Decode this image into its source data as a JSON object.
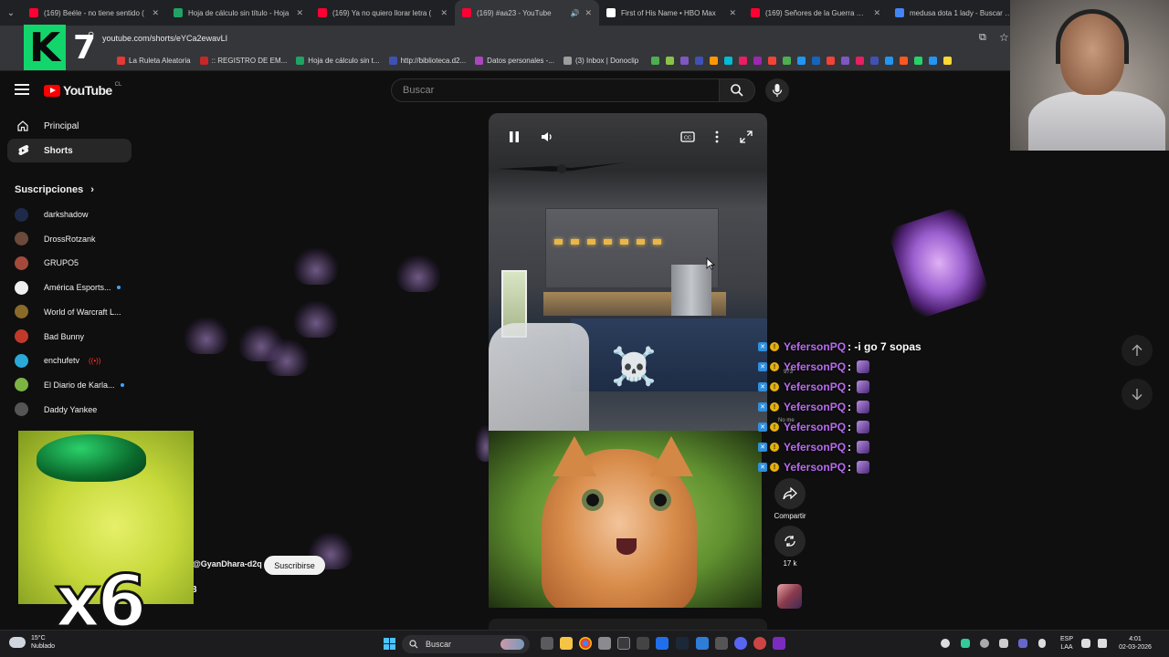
{
  "browser": {
    "tabs": [
      {
        "title": "(169) Beéle - no tiene sentido (",
        "favicon_color": "#ff0033",
        "active": false,
        "muted": false
      },
      {
        "title": "Hoja de cálculo sin título - Hoja",
        "favicon_color": "#1fa463",
        "active": false,
        "muted": false
      },
      {
        "title": "(169) Ya no quiero llorar letra (",
        "favicon_color": "#ff0033",
        "active": false,
        "muted": false
      },
      {
        "title": "(169) #aa23 - YouTube",
        "favicon_color": "#ff0033",
        "active": true,
        "muted": true
      },
      {
        "title": "First of His Name • HBO Max",
        "favicon_color": "#ffffff",
        "active": false,
        "muted": false
      },
      {
        "title": "(169) Señores de la Guerra — F",
        "favicon_color": "#ff0033",
        "active": false,
        "muted": false
      },
      {
        "title": "medusa dota 1 lady - Buscar co",
        "favicon_color": "#4285f4",
        "active": false,
        "muted": false
      }
    ],
    "close_glyph": "✕",
    "url": "youtube.com/shorts/eYCa2ewavLI",
    "bookmarks": [
      {
        "label": "La Ruleta Aleatoria",
        "color": "#e53935"
      },
      {
        "label": ":: REGISTRO DE EM...",
        "color": "#c62828"
      },
      {
        "label": "Hoja de cálculo sin t...",
        "color": "#1fa463"
      },
      {
        "label": "http://biblioteca.d2...",
        "color": "#3f51b5"
      },
      {
        "label": "Datos personales -...",
        "color": "#ab47bc"
      },
      {
        "label": "(3) Inbox | Donoclip",
        "color": "#9e9e9e"
      }
    ],
    "bookmark_icon_colors": [
      "#4caf50",
      "#8bc34a",
      "#7e57c2",
      "#3f51b5",
      "#ff9800",
      "#00bcd4",
      "#e91e63",
      "#9c27b0",
      "#f44336",
      "#4caf50",
      "#2196f3",
      "#1565c0",
      "#f44336",
      "#7e57c2",
      "#e91e63",
      "#3f51b5",
      "#2196f3",
      "#ff5722",
      "#25d366",
      "#2196f3",
      "#fdd835"
    ]
  },
  "overlay_logo": {
    "letter": "K",
    "number": "7"
  },
  "youtube": {
    "logo_text": "YouTube",
    "country_code": "CL",
    "search_placeholder": "Buscar",
    "sidebar": {
      "items": [
        {
          "label": "Principal",
          "icon": "home-icon"
        },
        {
          "label": "Shorts",
          "icon": "shorts-icon"
        }
      ],
      "subscriptions_title": "Suscripciones",
      "subscriptions_chevron": "›",
      "channels": [
        {
          "name": "darkshadow",
          "avatar_color": "#1d2a4a",
          "dot": false,
          "live": false
        },
        {
          "name": "DrossRotzank",
          "avatar_color": "#6b4a3a",
          "dot": false,
          "live": false
        },
        {
          "name": "GRUPO5",
          "avatar_color": "#a34a3a",
          "dot": false,
          "live": false
        },
        {
          "name": "América Esports...",
          "avatar_color": "#f0f0f0",
          "dot": true,
          "live": false
        },
        {
          "name": "World of Warcraft L...",
          "avatar_color": "#8a6a2a",
          "dot": false,
          "live": false
        },
        {
          "name": "Bad Bunny",
          "avatar_color": "#c0392b",
          "dot": false,
          "live": false
        },
        {
          "name": "enchufetv",
          "avatar_color": "#2aa8d8",
          "dot": false,
          "live": true
        },
        {
          "name": "El Diario de Karla...",
          "avatar_color": "#7cb342",
          "dot": true,
          "live": false
        },
        {
          "name": "Daddy Yankee",
          "avatar_color": "#555555",
          "dot": false,
          "live": false
        }
      ]
    },
    "short": {
      "channel_handle": "@GyanDhara-d2q",
      "subscribe_label": "Suscribirse",
      "stray_digit": "3",
      "skull_glyph": "☠️",
      "actions": [
        {
          "label": "Compartir",
          "icon": "share-icon"
        },
        {
          "label": "17 k",
          "icon": "remix-icon"
        }
      ]
    }
  },
  "chat": [
    {
      "user": "YefersonPQ",
      "message": ": -i go 7 sopas",
      "emote": false
    },
    {
      "user": "YefersonPQ",
      "message": ":",
      "emote": true
    },
    {
      "user": "YefersonPQ",
      "message": ":",
      "emote": true
    },
    {
      "user": "YefersonPQ",
      "message": ":",
      "emote": true
    },
    {
      "user": "YefersonPQ",
      "message": ":",
      "emote": true
    },
    {
      "user": "YefersonPQ",
      "message": ":",
      "emote": true
    },
    {
      "user": "YefersonPQ",
      "message": ":",
      "emote": true
    }
  ],
  "chat_ghost_text": [
    "973",
    "No me"
  ],
  "overlay_multiplier": "x6",
  "taskbar": {
    "weather_temp": "15°C",
    "weather_desc": "Nublado",
    "search_label": "Buscar",
    "lang_line1": "ESP",
    "lang_line2": "LAA",
    "time": "4:01",
    "date": "02-03-2026"
  },
  "colors": {
    "accent": "#ff0000",
    "chat_user": "#b86bf0",
    "k7_green": "#12d66c"
  }
}
